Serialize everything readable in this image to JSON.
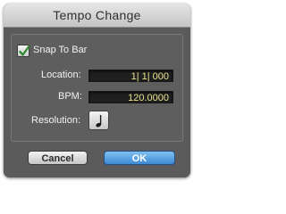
{
  "dialog": {
    "title": "Tempo Change",
    "snap_to_bar": {
      "label": "Snap To Bar",
      "checked": true
    },
    "location": {
      "label": "Location:",
      "value": "1| 1| 000"
    },
    "bpm": {
      "label": "BPM:",
      "value": "120.0000"
    },
    "resolution": {
      "label": "Resolution:",
      "icon": "quarter-note-icon"
    },
    "buttons": {
      "cancel": "Cancel",
      "ok": "OK"
    }
  },
  "colors": {
    "body_background": "#5b5b5b",
    "field_text": "#e8e08a",
    "checkmark": "#2e8a2e",
    "ok_button": "#3e8ad6"
  }
}
